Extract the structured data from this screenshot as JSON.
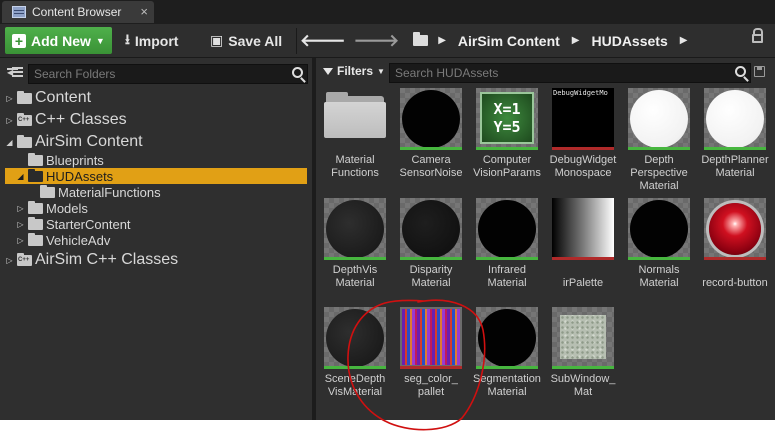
{
  "tab": {
    "title": "Content Browser",
    "icon": "content-browser-icon",
    "close": "×"
  },
  "toolbar": {
    "add_new": "Add New",
    "import": "Import",
    "save_all": "Save All",
    "breadcrumbs": [
      "AirSim Content",
      "HUDAssets"
    ],
    "accent_green": "#4fb04b"
  },
  "folders": {
    "search_placeholder": "Search Folders",
    "tree": [
      {
        "label": "Content",
        "expander": "▷",
        "kind": "folder",
        "size": "big"
      },
      {
        "label": "C++ Classes",
        "expander": "▷",
        "kind": "code",
        "size": "big"
      },
      {
        "label": "AirSim Content",
        "expander": "◢",
        "kind": "folder",
        "size": "big"
      },
      {
        "label": "Blueprints",
        "expander": "",
        "kind": "folder",
        "size": "small"
      },
      {
        "label": "HUDAssets",
        "expander": "◢",
        "kind": "folder",
        "size": "small",
        "selected": true
      },
      {
        "label": "MaterialFunctions",
        "expander": "",
        "kind": "folder",
        "size": "small"
      },
      {
        "label": "Models",
        "expander": "▷",
        "kind": "folder",
        "size": "small"
      },
      {
        "label": "StarterContent",
        "expander": "▷",
        "kind": "folder",
        "size": "small"
      },
      {
        "label": "VehicleAdv",
        "expander": "▷",
        "kind": "folder",
        "size": "small"
      },
      {
        "label": "AirSim C++ Classes",
        "expander": "▷",
        "kind": "code",
        "size": "big"
      }
    ],
    "selection_color": "#e1a015"
  },
  "assets": {
    "filters_label": "Filters",
    "search_placeholder": "Search HUDAssets",
    "items": [
      {
        "label": "Material Functions",
        "thumb": "folder"
      },
      {
        "label": "Camera SensorNoise",
        "thumb": "sphere-black"
      },
      {
        "label": "Computer VisionParams",
        "thumb": "cv-params",
        "thumb_text": [
          "X=1",
          "Y=5"
        ]
      },
      {
        "label": "DebugWidget Monospace",
        "thumb": "debug-font",
        "thumb_text": "DebugWidgetMo"
      },
      {
        "label": "Depth Perspective Material",
        "thumb": "sphere-white"
      },
      {
        "label": "DepthPlanner Material",
        "thumb": "sphere-white"
      },
      {
        "label": "DepthVis Material",
        "thumb": "sphere-dark"
      },
      {
        "label": "Disparity Material",
        "thumb": "sphere-mid"
      },
      {
        "label": "Infrared Material",
        "thumb": "sphere-black"
      },
      {
        "label": "irPalette",
        "thumb": "gradient"
      },
      {
        "label": "Normals Material",
        "thumb": "sphere-black"
      },
      {
        "label": "record-button",
        "thumb": "red-button"
      },
      {
        "label": "SceneDepth VisMaterial",
        "thumb": "sphere-dark"
      },
      {
        "label": "seg_color_ pallet",
        "thumb": "stripes"
      },
      {
        "label": "Segmentation Material",
        "thumb": "sphere-black"
      },
      {
        "label": "SubWindow_ Mat",
        "thumb": "texture"
      }
    ]
  },
  "annotation": {
    "color": "#d01010",
    "target": "seg_color_ pallet"
  }
}
